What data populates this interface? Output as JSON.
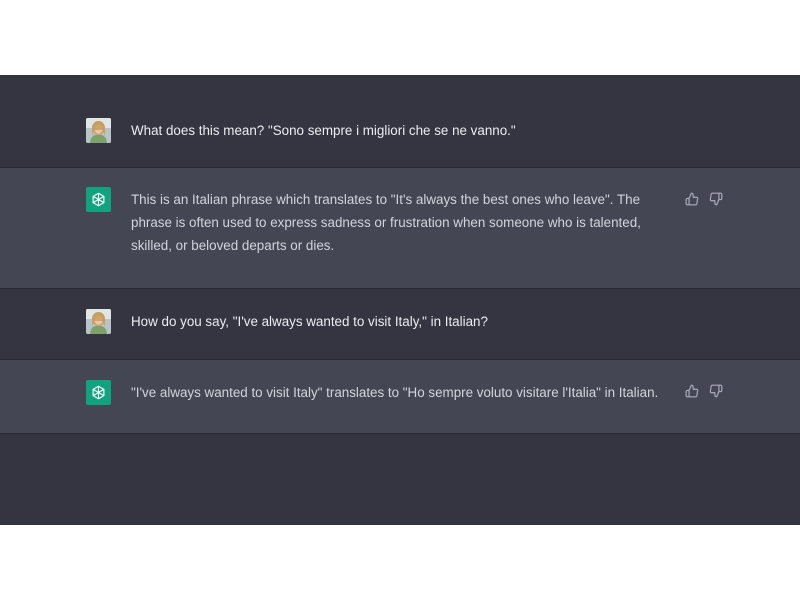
{
  "conversation": [
    {
      "role": "user",
      "avatar_icon": "user-avatar-photo",
      "text": "What does this mean? \"Sono sempre i migliori che se ne vanno.\""
    },
    {
      "role": "assistant",
      "avatar_icon": "openai-logo-icon",
      "text": "This is an Italian phrase which translates to \"It's always the best ones who leave\". The phrase is often used to express sadness or frustration when someone who is talented, skilled, or beloved departs or dies.",
      "feedback_icons": [
        "thumbs-up-icon",
        "thumbs-down-icon"
      ]
    },
    {
      "role": "user",
      "avatar_icon": "user-avatar-photo",
      "text": "How do you say, \"I've always wanted to visit Italy,\" in Italian?"
    },
    {
      "role": "assistant",
      "avatar_icon": "openai-logo-icon",
      "text": "\"I've always wanted to visit Italy\" translates to \"Ho sempre voluto visitare l'Italia\" in Italian.",
      "feedback_icons": [
        "thumbs-up-icon",
        "thumbs-down-icon"
      ]
    }
  ],
  "colors": {
    "user_bg": "#343541",
    "assistant_bg": "#444654",
    "accent": "#10a37f",
    "text": "#ececf1"
  }
}
